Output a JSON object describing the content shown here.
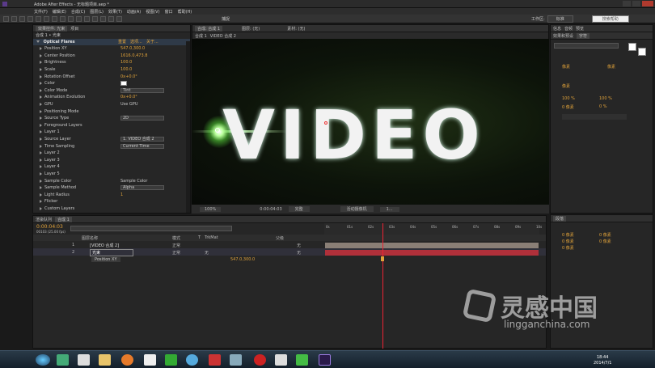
{
  "window": {
    "title": "Adobe After Effects - 无标题项目.aep *"
  },
  "menu": [
    "文件(F)",
    "编辑(E)",
    "合成(C)",
    "图层(L)",
    "效果(T)",
    "动画(A)",
    "视图(V)",
    "窗口",
    "帮助(H)"
  ],
  "toolbar": {
    "snap_label": "捕捉",
    "workspace_label": "工作区:",
    "workspace_value": "标准",
    "search_placeholder": "搜索帮助"
  },
  "effect_panel": {
    "tabs": [
      "效果控件: 光束",
      "项目"
    ],
    "header": "合成 1 • 光束",
    "effect_name": "Optical Flares",
    "header_links": [
      "重置",
      "选项...",
      "关于..."
    ],
    "properties": [
      {
        "name": "Position XY",
        "value": "547.0,300.0",
        "kind": "val"
      },
      {
        "name": "Center Position",
        "value": "1616.0,473.8",
        "kind": "val"
      },
      {
        "name": "Brightness",
        "value": "100.0",
        "kind": "val"
      },
      {
        "name": "Scale",
        "value": "100.0",
        "kind": "val"
      },
      {
        "name": "Rotation Offset",
        "value": "0x+0.0°",
        "kind": "val"
      },
      {
        "name": "Color",
        "value": "",
        "kind": "color"
      },
      {
        "name": "Color Mode",
        "value": "Tint",
        "kind": "dd"
      },
      {
        "name": "Animation Evolution",
        "value": "0x+0.0°",
        "kind": "val"
      },
      {
        "name": "GPU",
        "value": "Use GPU",
        "kind": "txt"
      },
      {
        "name": "Positioning Mode",
        "value": "",
        "kind": "group"
      },
      {
        "name": "Source Type",
        "value": "2D",
        "kind": "dd"
      },
      {
        "name": "Foreground Layers",
        "value": "",
        "kind": "group"
      },
      {
        "name": "Layer 1",
        "value": "",
        "kind": "group"
      },
      {
        "name": "Source Layer",
        "value": "1. VIDEO 合成 2",
        "kind": "dd"
      },
      {
        "name": "Time Sampling",
        "value": "Current Time",
        "kind": "dd"
      },
      {
        "name": "Layer 2",
        "value": "",
        "kind": "group"
      },
      {
        "name": "Layer 3",
        "value": "",
        "kind": "group"
      },
      {
        "name": "Layer 4",
        "value": "",
        "kind": "group"
      },
      {
        "name": "Layer 5",
        "value": "",
        "kind": "group"
      },
      {
        "name": "Sample Color",
        "value": "Sample Color",
        "kind": "txt"
      },
      {
        "name": "Sample Method",
        "value": "Alpha",
        "kind": "dd"
      },
      {
        "name": "Light Radius",
        "value": "1",
        "kind": "val"
      },
      {
        "name": "Flicker",
        "value": "",
        "kind": "group"
      },
      {
        "name": "Custom Layers",
        "value": "",
        "kind": "group"
      }
    ]
  },
  "viewer": {
    "tabs": [
      "合成: 合成 1",
      "图层: (无)",
      "素材: (无)"
    ],
    "sub_tabs": [
      "合成 1",
      "VIDEO 合成 2"
    ],
    "text": "VIDEO",
    "footer": {
      "zoom": "100%",
      "timecode": "0:00:04:03",
      "resolution": "完整",
      "camera": "活动摄像机",
      "views": "1..."
    }
  },
  "right_panel": {
    "tabs": [
      "信息",
      "音频",
      "预览",
      "效果和预设",
      "字符"
    ],
    "align_label": "对齐",
    "char_values": [
      "像素",
      "像素",
      "像素",
      "100 %",
      "100 %",
      "0 像素",
      "0 %"
    ]
  },
  "paragraph_panel": {
    "tabs": [
      "段落"
    ],
    "values": [
      "0 像素",
      "0 像素",
      "0 像素",
      "0 像素",
      "0 像素"
    ]
  },
  "timeline": {
    "tabs": [
      "渲染队列",
      "合成 1"
    ],
    "timecode": "0:00:04:03",
    "fps": "00103 (25.00 fps)",
    "columns": [
      "图层名称",
      "模式",
      "T",
      "TrkMat",
      "父级"
    ],
    "layers": [
      {
        "index": "1",
        "name": "[VIDEO 合成 2]",
        "mode": "正常",
        "trkmat": "",
        "parent": "无"
      },
      {
        "index": "2",
        "name": "光束",
        "mode": "正常",
        "trkmat": "无",
        "parent": "无"
      }
    ],
    "sub_prop": {
      "name": "Position XY",
      "value": "547.0,300.0"
    },
    "ruler": [
      "0s",
      "01s",
      "02s",
      "03s",
      "04s",
      "05s",
      "06s",
      "07s",
      "08s",
      "09s",
      "10s"
    ]
  },
  "taskbar": {
    "time": "18:44",
    "date": "2014/7/1"
  },
  "watermark": {
    "title": "灵感中国",
    "url": "lingganchina.com"
  }
}
